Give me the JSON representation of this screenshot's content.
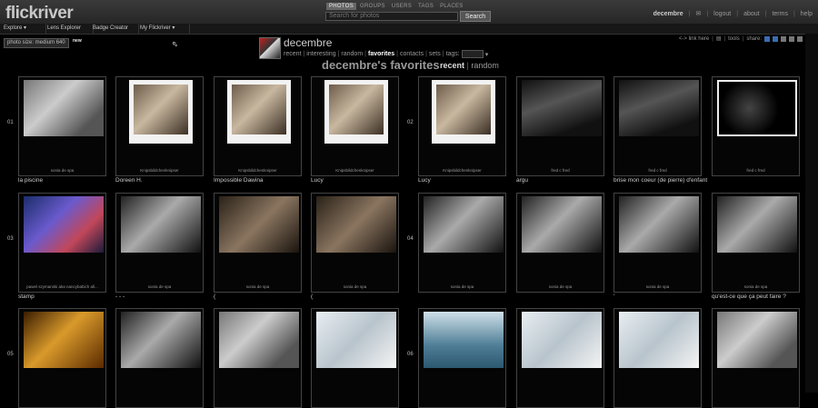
{
  "header": {
    "logo": "flickriver",
    "search_tabs": [
      "PHOTOS",
      "GROUPS",
      "USERS",
      "TAGS",
      "PLACES"
    ],
    "search_placeholder": "Search for photos",
    "search_button": "Search",
    "user": "decembre",
    "links": [
      "logout",
      "about",
      "terms",
      "help"
    ]
  },
  "menu": {
    "items": [
      "Explore",
      "Lens Explorer",
      "Badge Creator",
      "My Flickriver"
    ]
  },
  "controls": {
    "photo_size": "photo size: medium 640",
    "new_badge": "new"
  },
  "profile": {
    "name": "decembre",
    "nav": [
      "recent",
      "interesting",
      "random",
      "favorites",
      "contacts",
      "sets",
      "tags:"
    ],
    "current": "favorites"
  },
  "page": {
    "title": "decembre's favorites",
    "sort": [
      "recent",
      "random"
    ],
    "sort_current": "recent"
  },
  "tools": {
    "link_here": "<-> link here",
    "tools": "tools",
    "share": "share:"
  },
  "rows": [
    {
      "page_left": "01",
      "page_right": "02",
      "tiles": [
        {
          "credit": "sonia de spa",
          "caption": "la piscine",
          "photo": "gray"
        },
        {
          "credit": "Knipsbildchenknipser",
          "caption": "Doreen H.",
          "photo": "polaroid"
        },
        {
          "credit": "Knipsbildchenknipser",
          "caption": "Impossible Dawina",
          "photo": "polaroid"
        },
        {
          "credit": "Knipsbildchenknipser",
          "caption": "Lucy",
          "photo": "polaroid"
        },
        {
          "credit": "Knipsbildchenknipser",
          "caption": "Lucy",
          "photo": "polaroid"
        },
        {
          "credit": "fred c fred",
          "caption": "argu",
          "photo": "dark"
        },
        {
          "credit": "fred c fred",
          "caption": "brise mon coeur (de pierre) d'enfant",
          "photo": "dark"
        },
        {
          "credit": "fred c fred",
          "caption": "",
          "photo": "black"
        }
      ]
    },
    {
      "page_left": "03",
      "page_right": "04",
      "tiles": [
        {
          "credit": "pawel szymanski aka nancybabich all...",
          "caption": "stamp",
          "photo": "blue"
        },
        {
          "credit": "sonia de spa",
          "caption": "- - -",
          "photo": "bw"
        },
        {
          "credit": "sonia de spa",
          "caption": "(",
          "photo": "sepia"
        },
        {
          "credit": "sonia de spa",
          "caption": "(",
          "photo": "sepia"
        },
        {
          "credit": "sonia de spa",
          "caption": "",
          "photo": "bw"
        },
        {
          "credit": "sonia de spa",
          "caption": "",
          "photo": "bw"
        },
        {
          "credit": "sonia de spa",
          "caption": "'",
          "photo": "bw"
        },
        {
          "credit": "sonia de spa",
          "caption": "qu'est-ce que ça peut faire ?",
          "photo": "bw"
        }
      ]
    },
    {
      "page_left": "05",
      "page_right": "06",
      "tiles": [
        {
          "credit": "",
          "caption": "",
          "photo": "warm"
        },
        {
          "credit": "",
          "caption": "",
          "photo": "bw"
        },
        {
          "credit": "",
          "caption": "",
          "photo": "gray"
        },
        {
          "credit": "",
          "caption": "",
          "photo": "light"
        },
        {
          "credit": "",
          "caption": "",
          "photo": "sea"
        },
        {
          "credit": "",
          "caption": "",
          "photo": "light"
        },
        {
          "credit": "",
          "caption": "",
          "photo": "light"
        },
        {
          "credit": "",
          "caption": "",
          "photo": "gray"
        }
      ]
    }
  ]
}
